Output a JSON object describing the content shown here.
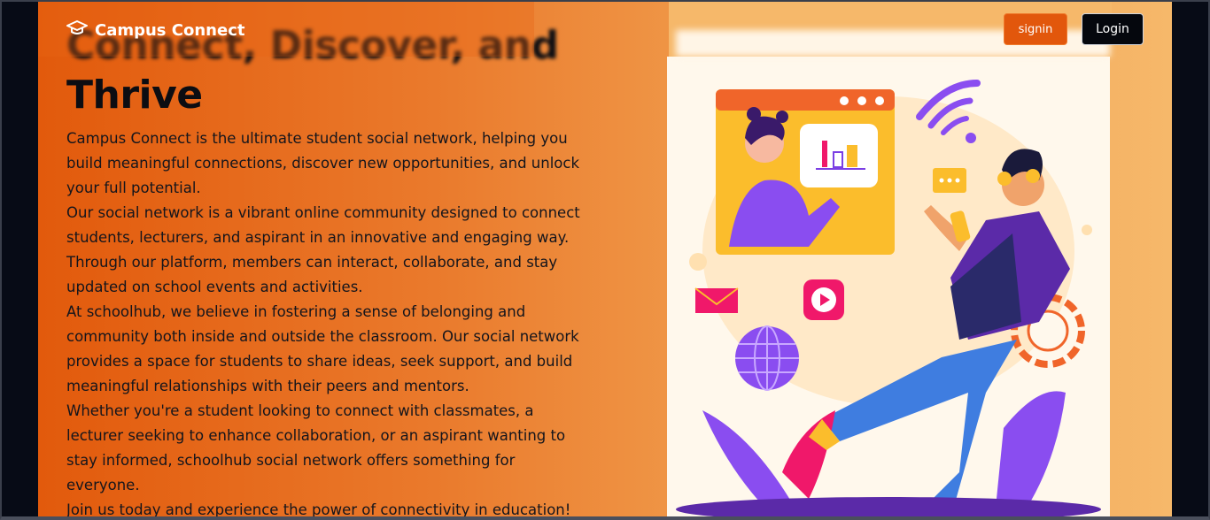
{
  "nav": {
    "brand": "Campus Connect",
    "signin_label": "signin",
    "login_label": "Login"
  },
  "hero": {
    "title_line1": "Connect, Discover, and",
    "title_line2": "Thrive",
    "paragraphs": [
      "Campus Connect is the ultimate student social network, helping you build meaningful connections, discover new opportunities, and unlock your full potential.",
      "Our social network is a vibrant online community designed to connect students, lecturers, and aspirant in an innovative and engaging way. Through our platform, members can interact, collaborate, and stay updated on school events and activities.",
      "At schoolhub, we believe in fostering a sense of belonging and community both inside and outside the classroom. Our social network provides a space for students to share ideas, seek support, and build meaningful relationships with their peers and mentors.",
      "Whether you're a student looking to connect with classmates, a lecturer seeking to enhance collaboration, or an aspirant wanting to stay informed, schoolhub social network offers something for everyone.",
      "Join us today and experience the power of connectivity in education!"
    ]
  },
  "icons": {
    "brand_icon": "graduation-cap-icon"
  },
  "colors": {
    "accent": "#e2570c",
    "dark": "#05070d",
    "purple": "#7b3fe4",
    "pink": "#f0186a"
  }
}
